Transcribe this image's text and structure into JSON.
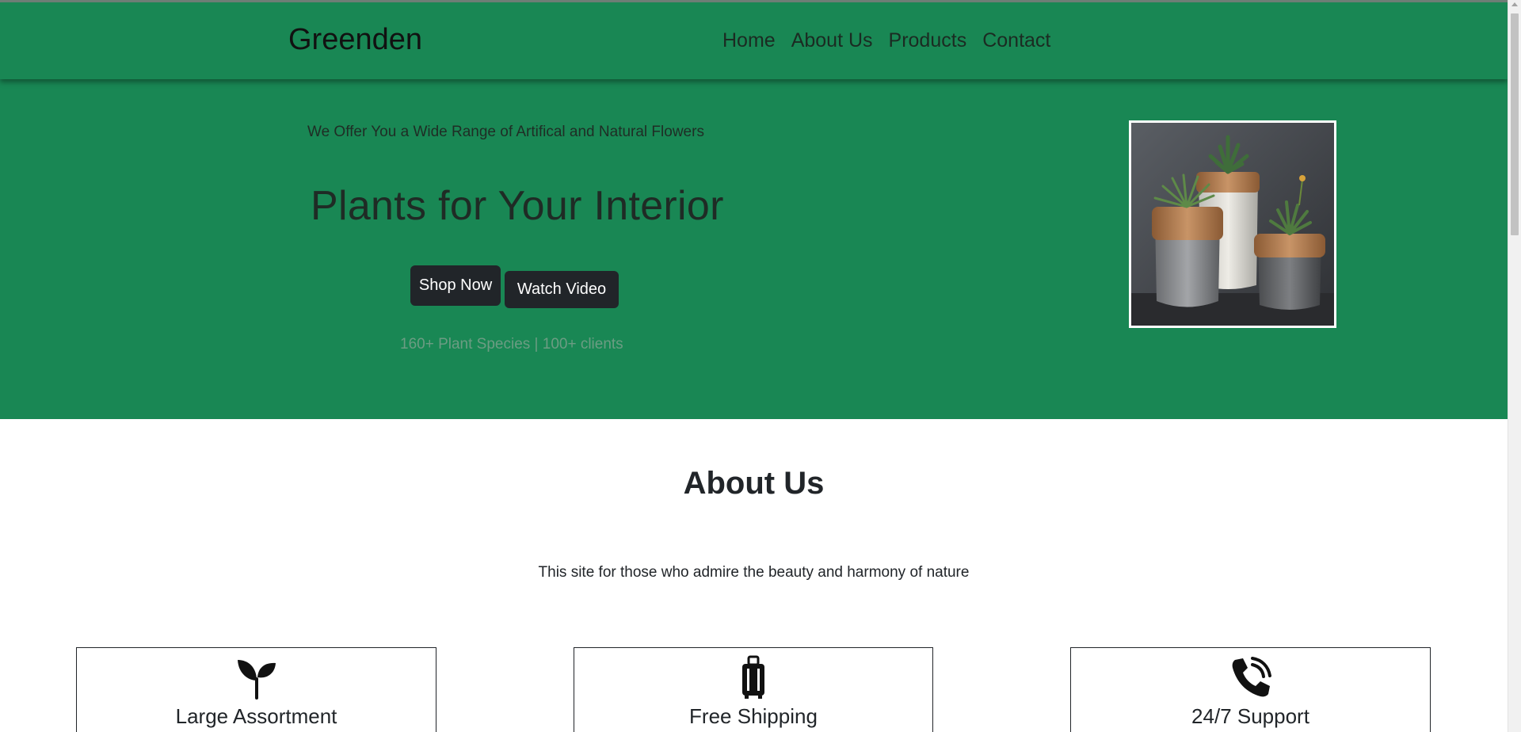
{
  "navbar": {
    "brand": "Greenden",
    "links": [
      "Home",
      "About Us",
      "Products",
      "Contact"
    ]
  },
  "hero": {
    "subtitle": "We Offer You a Wide Range of Artifical and Natural Flowers",
    "title": "Plants for Your Interior",
    "shop_button": "Shop Now",
    "video_button": "Watch Video",
    "stats": "160+ Plant Species | 100+ clients",
    "image_alt": "potted-plants-photo"
  },
  "about": {
    "title": "About Us",
    "text": "This site for those who admire the beauty and harmony of nature",
    "features": [
      {
        "label": "Large Assortment",
        "icon": "sprout-icon"
      },
      {
        "label": "Free Shipping",
        "icon": "luggage-icon"
      },
      {
        "label": "24/7 Support",
        "icon": "phone-icon"
      }
    ]
  },
  "colors": {
    "brand_green": "#198754",
    "button_dark": "#212529"
  }
}
